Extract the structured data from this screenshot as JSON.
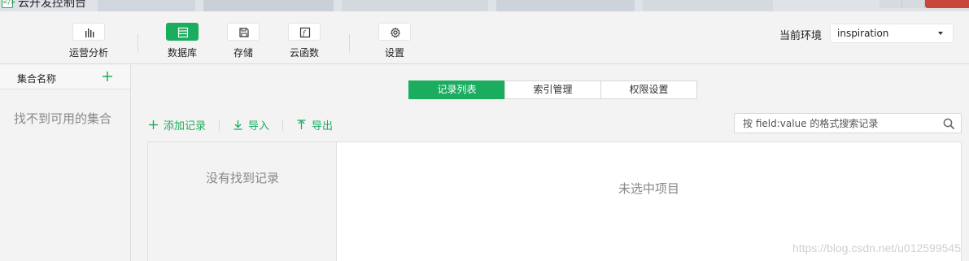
{
  "window": {
    "title": "云开发控制台"
  },
  "toolbar": {
    "items": [
      {
        "label": "运营分析",
        "icon": "bar-chart-icon",
        "active": false
      },
      {
        "label": "数据库",
        "icon": "database-icon",
        "active": true
      },
      {
        "label": "存储",
        "icon": "save-icon",
        "active": false
      },
      {
        "label": "云函数",
        "icon": "function-icon",
        "active": false
      },
      {
        "label": "设置",
        "icon": "gear-icon",
        "active": false
      }
    ],
    "env_label": "当前环境",
    "env_value": "inspiration"
  },
  "sidebar": {
    "header": "集合名称",
    "add_icon": "plus-icon",
    "empty_text": "找不到可用的集合"
  },
  "main": {
    "tabs": [
      {
        "label": "记录列表",
        "active": true
      },
      {
        "label": "索引管理",
        "active": false
      },
      {
        "label": "权限设置",
        "active": false
      }
    ],
    "actions": [
      {
        "label": "添加记录",
        "icon": "plus-icon"
      },
      {
        "label": "导入",
        "icon": "download-icon"
      },
      {
        "label": "导出",
        "icon": "upload-icon"
      }
    ],
    "search_placeholder": "按 field:value 的格式搜索记录",
    "list_empty": "没有找到记录",
    "detail_empty": "未选中项目"
  },
  "colors": {
    "accent": "#1aad5f",
    "background": "#f3f3f3"
  },
  "watermark": "https://blog.csdn.net/u012599545"
}
